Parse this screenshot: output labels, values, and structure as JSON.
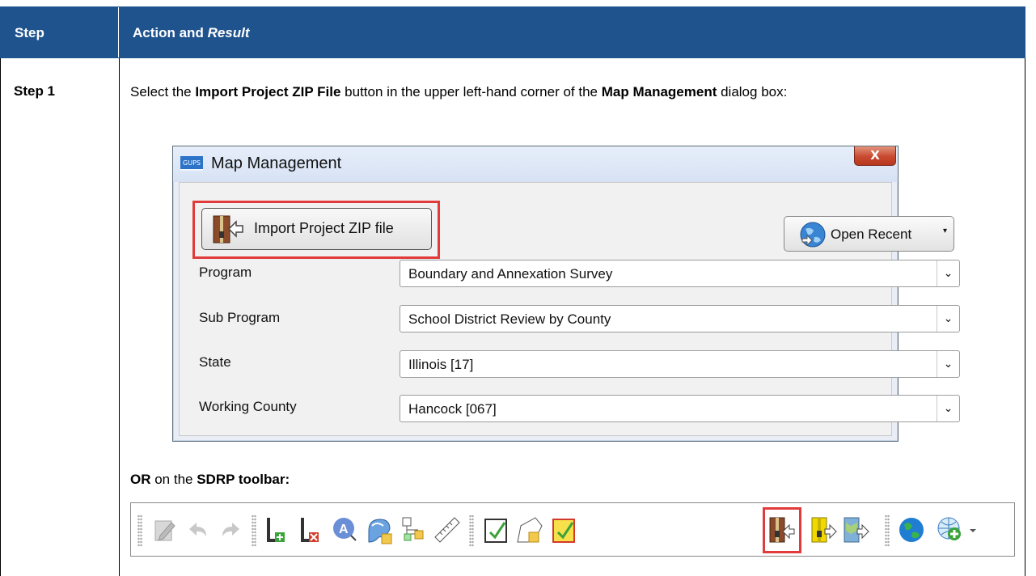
{
  "table": {
    "header_step": "Step",
    "header_action": "Action and ",
    "header_action_italic": "Result",
    "row1_step": "Step 1",
    "para1_a": "Select the ",
    "para1_b": "Import Project ZIP File",
    "para1_c": " button in the upper left-hand corner of the ",
    "para1_d": "Map Management",
    "para1_e": " dialog box:",
    "para2_a": "OR",
    "para2_b": " on the ",
    "para2_c": "SDRP toolbar:"
  },
  "dialog": {
    "app_icon_text": "GUPS",
    "title": "Map Management",
    "close_glyph": "X",
    "import_button": "Import Project ZIP file",
    "open_recent_button": "Open Recent",
    "open_recent_caret": "▾",
    "dropdown_glyph": "⌄",
    "fields": [
      {
        "label": "Program",
        "value": "Boundary and Annexation Survey"
      },
      {
        "label": "Sub Program",
        "value": "School District Review by County"
      },
      {
        "label": "State",
        "value": "Illinois [17]"
      },
      {
        "label": "Working County",
        "value": "Hancock [067]"
      }
    ]
  },
  "toolbar": {
    "icons": [
      "toggle-editing-icon",
      "undo-icon",
      "redo-icon",
      "add-feature-icon",
      "delete-feature-icon",
      "change-name-icon",
      "review-changes-icon",
      "topology-icon",
      "measure-icon",
      "validate-icon",
      "create-boundary-icon",
      "review-submission-icon",
      "import-project-zip-icon",
      "export-project-icon",
      "export-map-icon",
      "globe-icon",
      "add-wms-layer-icon"
    ],
    "highlighted_icon": "import-project-zip-icon",
    "highlight_color": "#e23b3b"
  },
  "colors": {
    "header_bg": "#1f538d",
    "highlight": "#e23b3b"
  }
}
